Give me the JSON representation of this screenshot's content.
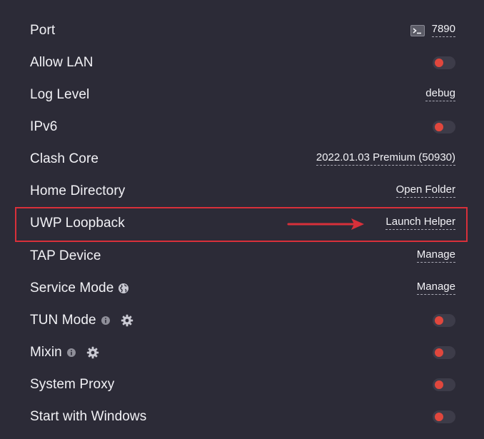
{
  "settings": {
    "port": {
      "label": "Port",
      "value": "7890",
      "icon": "terminal-icon"
    },
    "allow_lan": {
      "label": "Allow LAN",
      "enabled": false
    },
    "log_level": {
      "label": "Log Level",
      "value": "debug"
    },
    "ipv6": {
      "label": "IPv6",
      "enabled": false
    },
    "clash_core": {
      "label": "Clash Core",
      "value": "2022.01.03 Premium (50930)"
    },
    "home_directory": {
      "label": "Home Directory",
      "action": "Open Folder"
    },
    "uwp_loopback": {
      "label": "UWP Loopback",
      "action": "Launch Helper"
    },
    "tap_device": {
      "label": "TAP Device",
      "action": "Manage"
    },
    "service_mode": {
      "label": "Service Mode",
      "action": "Manage",
      "icon": "globe-icon"
    },
    "tun_mode": {
      "label": "TUN Mode",
      "enabled": false,
      "icons": [
        "info-icon",
        "gear-icon"
      ]
    },
    "mixin": {
      "label": "Mixin",
      "enabled": false,
      "icons": [
        "info-icon",
        "gear-icon"
      ]
    },
    "system_proxy": {
      "label": "System Proxy",
      "enabled": false
    },
    "start_with_windows": {
      "label": "Start with Windows",
      "enabled": false
    }
  },
  "colors": {
    "background": "#2c2b37",
    "toggle_track": "#3d3c49",
    "toggle_knob_off": "#e0473d",
    "annotation_red": "#d8303a"
  }
}
